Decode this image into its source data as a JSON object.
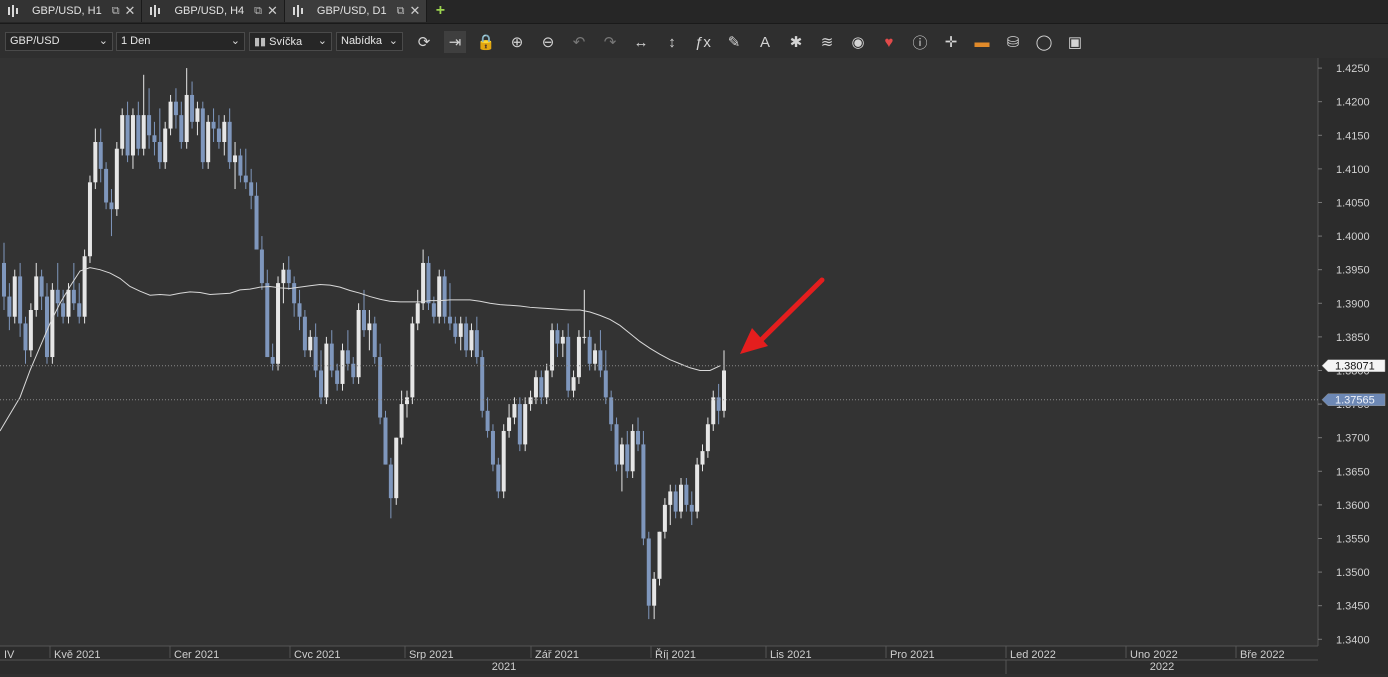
{
  "tabs": [
    {
      "label": "GBP/USD, H1",
      "active": false
    },
    {
      "label": "GBP/USD, H4",
      "active": false
    },
    {
      "label": "GBP/USD, D1",
      "active": true
    }
  ],
  "toolbar": {
    "symbol": "GBP/USD",
    "period": "1 Den",
    "chart_type": "Svíčka",
    "price_side": "Nabídka",
    "icons": [
      "refresh-icon",
      "autoscroll-icon",
      "lock-icon",
      "zoom-in-icon",
      "zoom-out-icon",
      "undo-icon",
      "redo-icon",
      "horizontal-line-icon",
      "vertical-line-icon",
      "function-icon",
      "pencil-icon",
      "text-icon",
      "sparkle-icon",
      "layers-icon",
      "eye-icon",
      "heart-line-icon",
      "info-icon",
      "crosshair-icon",
      "ruler-icon",
      "paint-bucket-icon",
      "cycle-icon",
      "save-icon"
    ]
  },
  "chart_data": {
    "type": "candlestick",
    "price_axis": {
      "ticks": [
        "1.4250",
        "1.4200",
        "1.4150",
        "1.4100",
        "1.4050",
        "1.4000",
        "1.3950",
        "1.3900",
        "1.3850",
        "1.3800",
        "1.3750",
        "1.3700",
        "1.3650",
        "1.3600",
        "1.3550",
        "1.3500",
        "1.3450",
        "1.3400"
      ],
      "ylim": [
        1.339,
        1.4265
      ]
    },
    "price_labels": {
      "ma_value": "1.38071",
      "last_price": "1.37565"
    },
    "time_axis": {
      "months": [
        "IV",
        "Kvě 2021",
        "Cer 2021",
        "Cvc 2021",
        "Srp 2021",
        "Zář 2021",
        "Říj 2021",
        "Lis 2021",
        "Pro 2021",
        "Led 2022",
        "Uno 2022",
        "Bře 2022"
      ],
      "years": [
        "2021",
        "2022"
      ]
    },
    "colors": {
      "bull": "#e6e6e6",
      "bear": "#7f97bd",
      "background": "#333333",
      "moving_average": "#d9d9d9",
      "arrow": "#e41e1e"
    },
    "candles": [
      [
        1.396,
        1.399,
        1.389,
        1.391
      ],
      [
        1.391,
        1.393,
        1.386,
        1.388
      ],
      [
        1.388,
        1.395,
        1.387,
        1.394
      ],
      [
        1.394,
        1.396,
        1.385,
        1.387
      ],
      [
        1.387,
        1.388,
        1.381,
        1.383
      ],
      [
        1.383,
        1.39,
        1.382,
        1.389
      ],
      [
        1.389,
        1.396,
        1.388,
        1.394
      ],
      [
        1.394,
        1.395,
        1.389,
        1.391
      ],
      [
        1.391,
        1.393,
        1.381,
        1.382
      ],
      [
        1.382,
        1.393,
        1.381,
        1.392
      ],
      [
        1.392,
        1.396,
        1.388,
        1.39
      ],
      [
        1.39,
        1.392,
        1.387,
        1.388
      ],
      [
        1.388,
        1.393,
        1.387,
        1.392
      ],
      [
        1.392,
        1.396,
        1.389,
        1.39
      ],
      [
        1.39,
        1.393,
        1.387,
        1.388
      ],
      [
        1.388,
        1.398,
        1.387,
        1.397
      ],
      [
        1.397,
        1.409,
        1.396,
        1.408
      ],
      [
        1.408,
        1.416,
        1.407,
        1.414
      ],
      [
        1.414,
        1.416,
        1.408,
        1.41
      ],
      [
        1.41,
        1.411,
        1.404,
        1.405
      ],
      [
        1.405,
        1.407,
        1.4,
        1.404
      ],
      [
        1.404,
        1.414,
        1.403,
        1.413
      ],
      [
        1.413,
        1.419,
        1.412,
        1.418
      ],
      [
        1.418,
        1.42,
        1.411,
        1.412
      ],
      [
        1.412,
        1.419,
        1.41,
        1.418
      ],
      [
        1.418,
        1.42,
        1.412,
        1.413
      ],
      [
        1.413,
        1.424,
        1.412,
        1.418
      ],
      [
        1.418,
        1.422,
        1.413,
        1.415
      ],
      [
        1.415,
        1.417,
        1.412,
        1.414
      ],
      [
        1.414,
        1.419,
        1.41,
        1.411
      ],
      [
        1.411,
        1.417,
        1.41,
        1.416
      ],
      [
        1.416,
        1.421,
        1.415,
        1.42
      ],
      [
        1.42,
        1.422,
        1.416,
        1.418
      ],
      [
        1.418,
        1.42,
        1.413,
        1.414
      ],
      [
        1.414,
        1.425,
        1.413,
        1.421
      ],
      [
        1.421,
        1.423,
        1.416,
        1.417
      ],
      [
        1.417,
        1.42,
        1.415,
        1.419
      ],
      [
        1.419,
        1.42,
        1.41,
        1.411
      ],
      [
        1.411,
        1.418,
        1.41,
        1.417
      ],
      [
        1.417,
        1.419,
        1.414,
        1.416
      ],
      [
        1.416,
        1.418,
        1.413,
        1.414
      ],
      [
        1.414,
        1.418,
        1.412,
        1.417
      ],
      [
        1.417,
        1.419,
        1.41,
        1.411
      ],
      [
        1.411,
        1.414,
        1.407,
        1.412
      ],
      [
        1.412,
        1.413,
        1.408,
        1.409
      ],
      [
        1.409,
        1.413,
        1.407,
        1.408
      ],
      [
        1.408,
        1.41,
        1.404,
        1.406
      ],
      [
        1.406,
        1.408,
        1.4,
        1.398
      ],
      [
        1.398,
        1.4,
        1.392,
        1.393
      ],
      [
        1.393,
        1.395,
        1.382,
        1.382
      ],
      [
        1.382,
        1.384,
        1.38,
        1.381
      ],
      [
        1.381,
        1.394,
        1.38,
        1.393
      ],
      [
        1.393,
        1.396,
        1.39,
        1.395
      ],
      [
        1.395,
        1.397,
        1.392,
        1.393
      ],
      [
        1.393,
        1.394,
        1.388,
        1.39
      ],
      [
        1.39,
        1.392,
        1.386,
        1.388
      ],
      [
        1.388,
        1.389,
        1.382,
        1.383
      ],
      [
        1.383,
        1.386,
        1.382,
        1.385
      ],
      [
        1.385,
        1.387,
        1.379,
        1.38
      ],
      [
        1.38,
        1.383,
        1.375,
        1.376
      ],
      [
        1.376,
        1.385,
        1.375,
        1.384
      ],
      [
        1.384,
        1.386,
        1.379,
        1.38
      ],
      [
        1.38,
        1.381,
        1.377,
        1.378
      ],
      [
        1.378,
        1.384,
        1.377,
        1.383
      ],
      [
        1.383,
        1.386,
        1.38,
        1.381
      ],
      [
        1.381,
        1.382,
        1.378,
        1.379
      ],
      [
        1.379,
        1.39,
        1.378,
        1.389
      ],
      [
        1.389,
        1.392,
        1.385,
        1.386
      ],
      [
        1.386,
        1.389,
        1.383,
        1.387
      ],
      [
        1.387,
        1.388,
        1.381,
        1.382
      ],
      [
        1.382,
        1.384,
        1.372,
        1.373
      ],
      [
        1.373,
        1.374,
        1.366,
        1.366
      ],
      [
        1.366,
        1.367,
        1.358,
        1.361
      ],
      [
        1.361,
        1.37,
        1.36,
        1.37
      ],
      [
        1.37,
        1.377,
        1.369,
        1.375
      ],
      [
        1.375,
        1.377,
        1.373,
        1.376
      ],
      [
        1.376,
        1.388,
        1.375,
        1.387
      ],
      [
        1.387,
        1.392,
        1.386,
        1.39
      ],
      [
        1.39,
        1.398,
        1.389,
        1.396
      ],
      [
        1.396,
        1.397,
        1.389,
        1.39
      ],
      [
        1.39,
        1.391,
        1.387,
        1.388
      ],
      [
        1.388,
        1.395,
        1.387,
        1.394
      ],
      [
        1.394,
        1.395,
        1.387,
        1.388
      ],
      [
        1.388,
        1.393,
        1.386,
        1.387
      ],
      [
        1.387,
        1.388,
        1.384,
        1.385
      ],
      [
        1.385,
        1.388,
        1.383,
        1.387
      ],
      [
        1.387,
        1.388,
        1.382,
        1.383
      ],
      [
        1.383,
        1.387,
        1.382,
        1.386
      ],
      [
        1.386,
        1.388,
        1.381,
        1.382
      ],
      [
        1.382,
        1.383,
        1.373,
        1.374
      ],
      [
        1.374,
        1.376,
        1.37,
        1.371
      ],
      [
        1.371,
        1.372,
        1.365,
        1.366
      ],
      [
        1.366,
        1.367,
        1.361,
        1.362
      ],
      [
        1.362,
        1.372,
        1.361,
        1.371
      ],
      [
        1.371,
        1.375,
        1.37,
        1.373
      ],
      [
        1.373,
        1.376,
        1.372,
        1.375
      ],
      [
        1.375,
        1.376,
        1.368,
        1.369
      ],
      [
        1.369,
        1.376,
        1.368,
        1.375
      ],
      [
        1.375,
        1.377,
        1.374,
        1.376
      ],
      [
        1.376,
        1.38,
        1.375,
        1.379
      ],
      [
        1.379,
        1.38,
        1.375,
        1.376
      ],
      [
        1.376,
        1.381,
        1.375,
        1.38
      ],
      [
        1.38,
        1.387,
        1.379,
        1.386
      ],
      [
        1.386,
        1.387,
        1.382,
        1.384
      ],
      [
        1.384,
        1.386,
        1.382,
        1.385
      ],
      [
        1.385,
        1.387,
        1.376,
        1.377
      ],
      [
        1.377,
        1.38,
        1.376,
        1.379
      ],
      [
        1.379,
        1.386,
        1.378,
        1.385
      ],
      [
        1.385,
        1.392,
        1.384,
        1.385
      ],
      [
        1.385,
        1.386,
        1.38,
        1.381
      ],
      [
        1.381,
        1.384,
        1.38,
        1.383
      ],
      [
        1.383,
        1.386,
        1.379,
        1.38
      ],
      [
        1.38,
        1.383,
        1.375,
        1.376
      ],
      [
        1.376,
        1.377,
        1.371,
        1.372
      ],
      [
        1.372,
        1.373,
        1.365,
        1.366
      ],
      [
        1.366,
        1.37,
        1.362,
        1.369
      ],
      [
        1.369,
        1.371,
        1.364,
        1.365
      ],
      [
        1.365,
        1.372,
        1.364,
        1.371
      ],
      [
        1.371,
        1.373,
        1.368,
        1.369
      ],
      [
        1.369,
        1.371,
        1.354,
        1.355
      ],
      [
        1.355,
        1.356,
        1.343,
        1.345
      ],
      [
        1.345,
        1.35,
        1.343,
        1.349
      ],
      [
        1.349,
        1.356,
        1.348,
        1.356
      ],
      [
        1.356,
        1.361,
        1.355,
        1.36
      ],
      [
        1.36,
        1.363,
        1.357,
        1.362
      ],
      [
        1.362,
        1.363,
        1.358,
        1.359
      ],
      [
        1.359,
        1.364,
        1.358,
        1.363
      ],
      [
        1.363,
        1.364,
        1.359,
        1.36
      ],
      [
        1.36,
        1.362,
        1.357,
        1.359
      ],
      [
        1.359,
        1.367,
        1.358,
        1.366
      ],
      [
        1.366,
        1.369,
        1.365,
        1.368
      ],
      [
        1.368,
        1.373,
        1.367,
        1.372
      ],
      [
        1.372,
        1.377,
        1.371,
        1.376
      ],
      [
        1.376,
        1.378,
        1.372,
        1.374
      ],
      [
        1.374,
        1.383,
        1.373,
        1.38
      ]
    ],
    "moving_average": [
      [
        0,
        1.371
      ],
      [
        10,
        1.3735
      ],
      [
        20,
        1.376
      ],
      [
        30,
        1.38
      ],
      [
        40,
        1.3835
      ],
      [
        50,
        1.387
      ],
      [
        60,
        1.39
      ],
      [
        70,
        1.3925
      ],
      [
        80,
        1.3948
      ],
      [
        90,
        1.3953
      ],
      [
        100,
        1.395
      ],
      [
        110,
        1.3945
      ],
      [
        120,
        1.3937
      ],
      [
        130,
        1.3925
      ],
      [
        140,
        1.3918
      ],
      [
        150,
        1.3912
      ],
      [
        160,
        1.3913
      ],
      [
        170,
        1.3912
      ],
      [
        180,
        1.3915
      ],
      [
        190,
        1.3917
      ],
      [
        200,
        1.3916
      ],
      [
        210,
        1.3913
      ],
      [
        220,
        1.3914
      ],
      [
        230,
        1.3915
      ],
      [
        240,
        1.392
      ],
      [
        250,
        1.3921
      ],
      [
        260,
        1.3924
      ],
      [
        270,
        1.3925
      ],
      [
        280,
        1.3923
      ],
      [
        290,
        1.3922
      ],
      [
        300,
        1.3924
      ],
      [
        310,
        1.3926
      ],
      [
        320,
        1.3928
      ],
      [
        330,
        1.3927
      ],
      [
        340,
        1.3924
      ],
      [
        350,
        1.3919
      ],
      [
        360,
        1.3915
      ],
      [
        370,
        1.391
      ],
      [
        380,
        1.3906
      ],
      [
        390,
        1.3903
      ],
      [
        400,
        1.3902
      ],
      [
        410,
        1.3902
      ],
      [
        420,
        1.3902
      ],
      [
        430,
        1.3904
      ],
      [
        440,
        1.3904
      ],
      [
        450,
        1.3905
      ],
      [
        460,
        1.3905
      ],
      [
        470,
        1.3905
      ],
      [
        480,
        1.3903
      ],
      [
        490,
        1.39
      ],
      [
        500,
        1.3898
      ],
      [
        510,
        1.3897
      ],
      [
        520,
        1.3896
      ],
      [
        530,
        1.3894
      ],
      [
        540,
        1.3893
      ],
      [
        550,
        1.3892
      ],
      [
        560,
        1.3891
      ],
      [
        570,
        1.389
      ],
      [
        580,
        1.389
      ],
      [
        590,
        1.3887
      ],
      [
        600,
        1.3882
      ],
      [
        610,
        1.3876
      ],
      [
        620,
        1.3867
      ],
      [
        630,
        1.3855
      ],
      [
        640,
        1.3843
      ],
      [
        650,
        1.3833
      ],
      [
        660,
        1.3824
      ],
      [
        670,
        1.3816
      ],
      [
        680,
        1.381
      ],
      [
        690,
        1.3804
      ],
      [
        700,
        1.38
      ],
      [
        710,
        1.38
      ],
      [
        720,
        1.3807
      ]
    ]
  }
}
